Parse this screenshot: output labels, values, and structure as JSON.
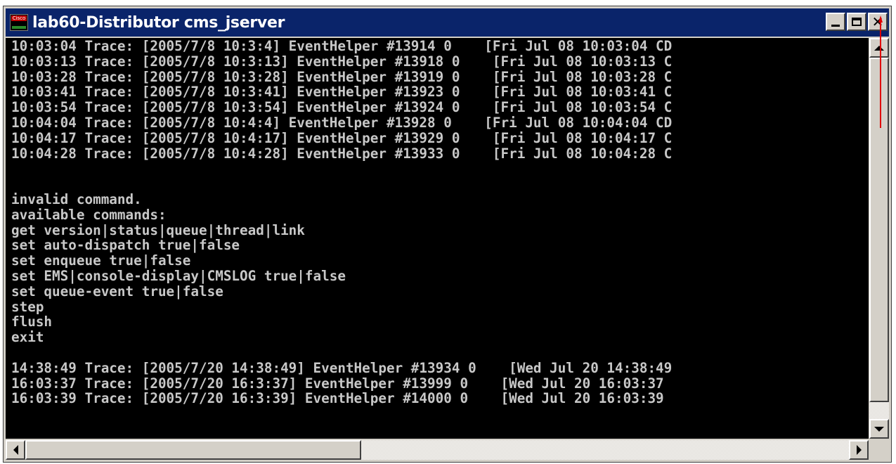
{
  "window": {
    "title": "lab60-Distributor cms_jserver",
    "icon_text": "Cisco"
  },
  "console": {
    "lines": [
      "10:03:04 Trace: [2005/7/8 10:3:4] EventHelper #13914 0    [Fri Jul 08 10:03:04 CD",
      "10:03:13 Trace: [2005/7/8 10:3:13] EventHelper #13918 0    [Fri Jul 08 10:03:13 C",
      "10:03:28 Trace: [2005/7/8 10:3:28] EventHelper #13919 0    [Fri Jul 08 10:03:28 C",
      "10:03:41 Trace: [2005/7/8 10:3:41] EventHelper #13923 0    [Fri Jul 08 10:03:41 C",
      "10:03:54 Trace: [2005/7/8 10:3:54] EventHelper #13924 0    [Fri Jul 08 10:03:54 C",
      "10:04:04 Trace: [2005/7/8 10:4:4] EventHelper #13928 0    [Fri Jul 08 10:04:04 CD",
      "10:04:17 Trace: [2005/7/8 10:4:17] EventHelper #13929 0    [Fri Jul 08 10:04:17 C",
      "10:04:28 Trace: [2005/7/8 10:4:28] EventHelper #13933 0    [Fri Jul 08 10:04:28 C",
      "",
      "",
      "invalid command.",
      "available commands:",
      "get version|status|queue|thread|link",
      "set auto-dispatch true|false",
      "set enqueue true|false",
      "set EMS|console-display|CMSLOG true|false",
      "set queue-event true|false",
      "step",
      "flush",
      "exit",
      "",
      "14:38:49 Trace: [2005/7/20 14:38:49] EventHelper #13934 0    [Wed Jul 20 14:38:49",
      "16:03:37 Trace: [2005/7/20 16:3:37] EventHelper #13999 0    [Wed Jul 20 16:03:37",
      "16:03:39 Trace: [2005/7/20 16:3:39] EventHelper #14000 0    [Wed Jul 20 16:03:39"
    ]
  },
  "colors": {
    "title_bar": "#0a246a",
    "console_bg": "#000000",
    "console_text": "#c8c8c8",
    "annotation": "#e00000"
  },
  "icons": {
    "minimize": "minimize-icon",
    "maximize": "maximize-icon",
    "close": "close-icon",
    "scroll_up": "arrow-up-icon",
    "scroll_down": "arrow-down-icon",
    "scroll_left": "arrow-left-icon",
    "scroll_right": "arrow-right-icon",
    "annotation": "red-arrow-annotation"
  }
}
